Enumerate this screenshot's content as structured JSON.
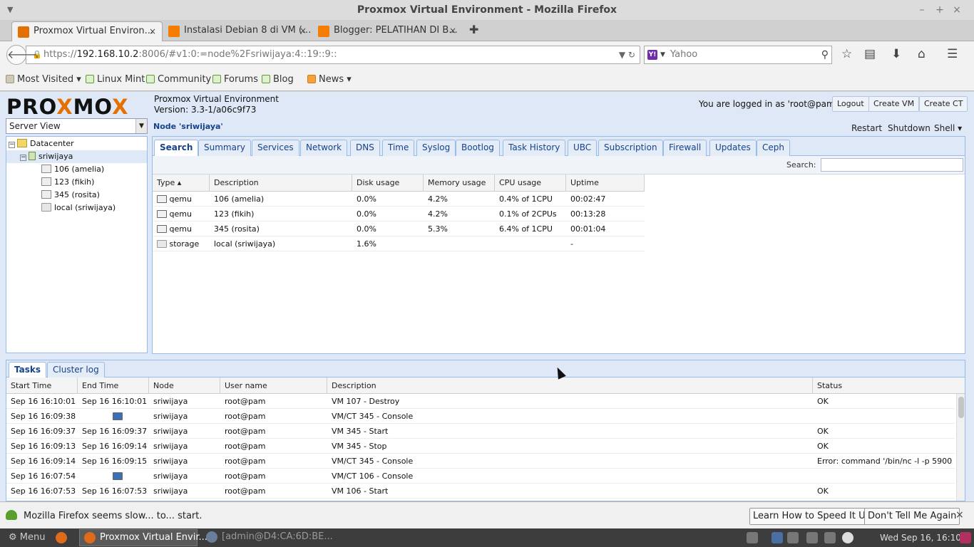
{
  "window": {
    "title": "Proxmox Virtual Environment - Mozilla Firefox",
    "minimize": "–",
    "maximize": "+",
    "close": "×",
    "menu_glyph": "▼"
  },
  "tabs": [
    {
      "title": "Proxmox Virtual Environ...",
      "close": "×",
      "favicon_color": "#e57000"
    },
    {
      "title": "Instalasi Debian 8 di VM (...",
      "close": "×",
      "favicon_color": "#f57d00"
    },
    {
      "title": "Blogger: PELATIHAN DI B...",
      "close": "×",
      "favicon_color": "#f57d00"
    }
  ],
  "new_tab": "✚",
  "nav": {
    "back": "🡐",
    "url_prefix": "https://",
    "url_host": "192.168.10.2",
    "url_rest": ":8006/#v1:0:=node%2Fsriwijaya:4::19::9::",
    "url_icons": "▼  ↻",
    "search_engine_badge": "Y!",
    "search_dropdown": "▼",
    "search_placeholder": "Yahoo",
    "search_glyph": "⚲",
    "icons": {
      "bookmark": "☆",
      "reading": "▤",
      "download": "⬇",
      "home": "⌂",
      "menu": "☰"
    }
  },
  "bookmarks": [
    {
      "label": "Most Visited ▾",
      "kind": "folder"
    },
    {
      "label": "Linux Mint",
      "kind": "site"
    },
    {
      "label": "Community",
      "kind": "site"
    },
    {
      "label": "Forums",
      "kind": "site"
    },
    {
      "label": "Blog",
      "kind": "site"
    },
    {
      "label": "News ▾",
      "kind": "rss"
    }
  ],
  "pve": {
    "logo_a": "PRO",
    "logo_x": "X",
    "logo_b": "MO",
    "logo_x2": "X",
    "product": "Proxmox Virtual Environment",
    "version": "Version: 3.3-1/a06c9f73",
    "login_text": "You are logged in as 'root@pam'",
    "buttons": {
      "logout": "Logout",
      "create_vm": "Create VM",
      "create_ct": "Create CT"
    },
    "view_selector": "Server View",
    "view_dropdown": "▼",
    "tree": [
      {
        "label": "Datacenter",
        "exp": "−"
      },
      {
        "label": "sriwijaya",
        "exp": "−"
      },
      {
        "label": "106 (amelia)"
      },
      {
        "label": "123 (fikih)"
      },
      {
        "label": "345 (rosita)"
      },
      {
        "label": "local (sriwijaya)"
      }
    ],
    "node_title": "Node 'sriwijaya'",
    "node_actions": {
      "restart": "Restart",
      "shutdown": "Shutdown",
      "shell": "Shell ▾"
    },
    "node_tabs": [
      "Search",
      "Summary",
      "Services",
      "Network",
      "DNS",
      "Time",
      "Syslog",
      "Bootlog",
      "Task History",
      "UBC",
      "Subscription",
      "Firewall",
      "Updates",
      "Ceph"
    ],
    "search_label": "Search:",
    "resource_columns": [
      "Type ▴",
      "Description",
      "Disk usage",
      "Memory usage",
      "CPU usage",
      "Uptime"
    ],
    "resources": [
      {
        "type": "qemu",
        "desc": "106 (amelia)",
        "disk": "0.0%",
        "mem": "4.2%",
        "cpu": "0.4% of 1CPU",
        "uptime": "00:02:47",
        "icon": "monitor-icon"
      },
      {
        "type": "qemu",
        "desc": "123 (fikih)",
        "disk": "0.0%",
        "mem": "4.2%",
        "cpu": "0.1% of 2CPUs",
        "uptime": "00:13:28",
        "icon": "monitor-icon"
      },
      {
        "type": "qemu",
        "desc": "345 (rosita)",
        "disk": "0.0%",
        "mem": "5.3%",
        "cpu": "6.4% of 1CPU",
        "uptime": "00:01:04",
        "icon": "monitor-icon"
      },
      {
        "type": "storage",
        "desc": "local (sriwijaya)",
        "disk": "1.6%",
        "mem": "",
        "cpu": "",
        "uptime": "-",
        "icon": "storage-icon"
      }
    ],
    "bottom_tabs": [
      "Tasks",
      "Cluster log"
    ],
    "task_columns": [
      "Start Time",
      "End Time",
      "Node",
      "User name",
      "Description",
      "Status"
    ],
    "tasks": [
      {
        "start": "Sep 16 16:10:01",
        "end": "Sep 16 16:10:01",
        "node": "sriwijaya",
        "user": "root@pam",
        "desc": "VM 107 - Destroy",
        "status": "OK",
        "running": false
      },
      {
        "start": "Sep 16 16:09:38",
        "end": "",
        "node": "sriwijaya",
        "user": "root@pam",
        "desc": "VM/CT 345 - Console",
        "status": "",
        "running": true
      },
      {
        "start": "Sep 16 16:09:37",
        "end": "Sep 16 16:09:37",
        "node": "sriwijaya",
        "user": "root@pam",
        "desc": "VM 345 - Start",
        "status": "OK",
        "running": false
      },
      {
        "start": "Sep 16 16:09:13",
        "end": "Sep 16 16:09:14",
        "node": "sriwijaya",
        "user": "root@pam",
        "desc": "VM 345 - Stop",
        "status": "OK",
        "running": false
      },
      {
        "start": "Sep 16 16:09:14",
        "end": "Sep 16 16:09:15",
        "node": "sriwijaya",
        "user": "root@pam",
        "desc": "VM/CT 345 - Console",
        "status": "Error: command '/bin/nc -l -p 5900 -...",
        "running": false
      },
      {
        "start": "Sep 16 16:07:54",
        "end": "",
        "node": "sriwijaya",
        "user": "root@pam",
        "desc": "VM/CT 106 - Console",
        "status": "",
        "running": true
      },
      {
        "start": "Sep 16 16:07:53",
        "end": "Sep 16 16:07:53",
        "node": "sriwijaya",
        "user": "root@pam",
        "desc": "VM 106 - Start",
        "status": "OK",
        "running": false
      }
    ]
  },
  "notification": {
    "message": "Mozilla Firefox seems slow... to... start.",
    "speed_button": "Learn How to Speed It Up",
    "dismiss_button": "Don't Tell Me Again",
    "close": "×"
  },
  "taskbar": {
    "menu": "⚙  Menu",
    "windows": [
      {
        "label": "Proxmox Virtual Envir...",
        "active": true
      },
      {
        "label": "[admin@D4:CA:6D:BE...",
        "active": false
      }
    ],
    "clock": "Wed Sep 16, 16:10"
  }
}
